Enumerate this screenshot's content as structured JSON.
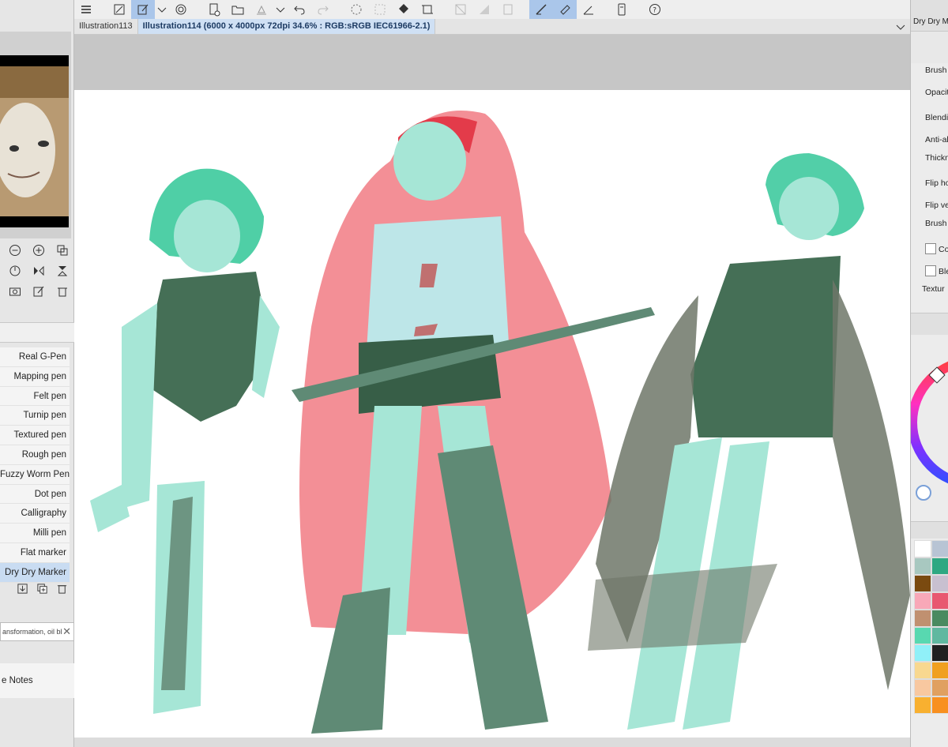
{
  "tabs": [
    {
      "label": "Illustration113",
      "active": false
    },
    {
      "label": "Illustration114 (6000 x 4000px 72dpi 34.6% : RGB:sRGB IEC61966-2.1)",
      "active": true
    }
  ],
  "brushes": [
    {
      "label": "Real G-Pen"
    },
    {
      "label": "Mapping pen"
    },
    {
      "label": "Felt pen"
    },
    {
      "label": "Turnip pen"
    },
    {
      "label": "Textured pen"
    },
    {
      "label": "Rough pen"
    },
    {
      "label": "Fuzzy Worm Pen"
    },
    {
      "label": "Dot pen"
    },
    {
      "label": "Calligraphy"
    },
    {
      "label": "Milli pen"
    },
    {
      "label": "Flat marker"
    },
    {
      "label": "Dry Dry Marker",
      "selected": true
    }
  ],
  "search": {
    "text": "ansformation, oil bl"
  },
  "notes": {
    "label": "e Notes"
  },
  "tool_property": {
    "title": "Dry Dry M",
    "props": [
      "Brush",
      "Opacit",
      "Blendi",
      "Anti-al",
      "Thickn",
      "Flip ho",
      "Flip ve",
      "Brush",
      "Co",
      "Ble",
      "Textur"
    ]
  },
  "colors": {
    "accent": "#aac6ea",
    "selected_tab": "#cfe0f4",
    "canvas_bg": "#c6c6c6"
  },
  "swatches": [
    [
      "#ffffff",
      "#b8c4d4"
    ],
    [
      "#a8c8c0",
      "#2ea882"
    ],
    [
      "#7a4a10",
      "#c8c0d0"
    ],
    [
      "#f8a8b8",
      "#e85870"
    ],
    [
      "#c09070",
      "#4a8a60"
    ],
    [
      "#58d8b0",
      "#60b8a0"
    ],
    [
      "#90f0f8",
      "#202020"
    ],
    [
      "#f8d890",
      "#f0a020"
    ],
    [
      "#f8c8a0",
      "#e0a060"
    ],
    [
      "#f8b030",
      "#f89020"
    ]
  ]
}
